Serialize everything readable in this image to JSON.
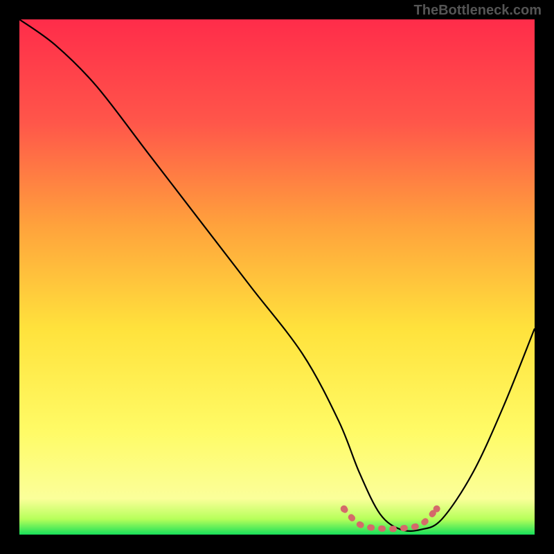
{
  "watermark": "TheBottleneck.com",
  "chart_data": {
    "type": "line",
    "title": "",
    "xlabel": "",
    "ylabel": "",
    "xlim": [
      0,
      100
    ],
    "ylim": [
      0,
      100
    ],
    "gradient_stops": [
      {
        "offset": 0,
        "color": "#ff2c4a"
      },
      {
        "offset": 20,
        "color": "#ff564a"
      },
      {
        "offset": 40,
        "color": "#ffa23c"
      },
      {
        "offset": 60,
        "color": "#ffe23c"
      },
      {
        "offset": 80,
        "color": "#fffb66"
      },
      {
        "offset": 93,
        "color": "#fbff9a"
      },
      {
        "offset": 97,
        "color": "#b6ff5a"
      },
      {
        "offset": 100,
        "color": "#17e05a"
      }
    ],
    "series": [
      {
        "name": "bottleneck-curve",
        "x": [
          0,
          7,
          15,
          25,
          35,
          45,
          55,
          62,
          66,
          70,
          74,
          78,
          82,
          88,
          94,
          100
        ],
        "y": [
          100,
          95,
          87,
          74,
          61,
          48,
          35,
          22,
          12,
          4,
          1,
          1,
          3,
          12,
          25,
          40
        ]
      }
    ],
    "marker_segment": {
      "name": "optimal-range",
      "x": [
        63,
        66,
        70,
        74,
        78,
        81
      ],
      "y": [
        5,
        2,
        1.2,
        1.2,
        2,
        5
      ],
      "style": "dotted",
      "color": "#d46a6a"
    }
  }
}
